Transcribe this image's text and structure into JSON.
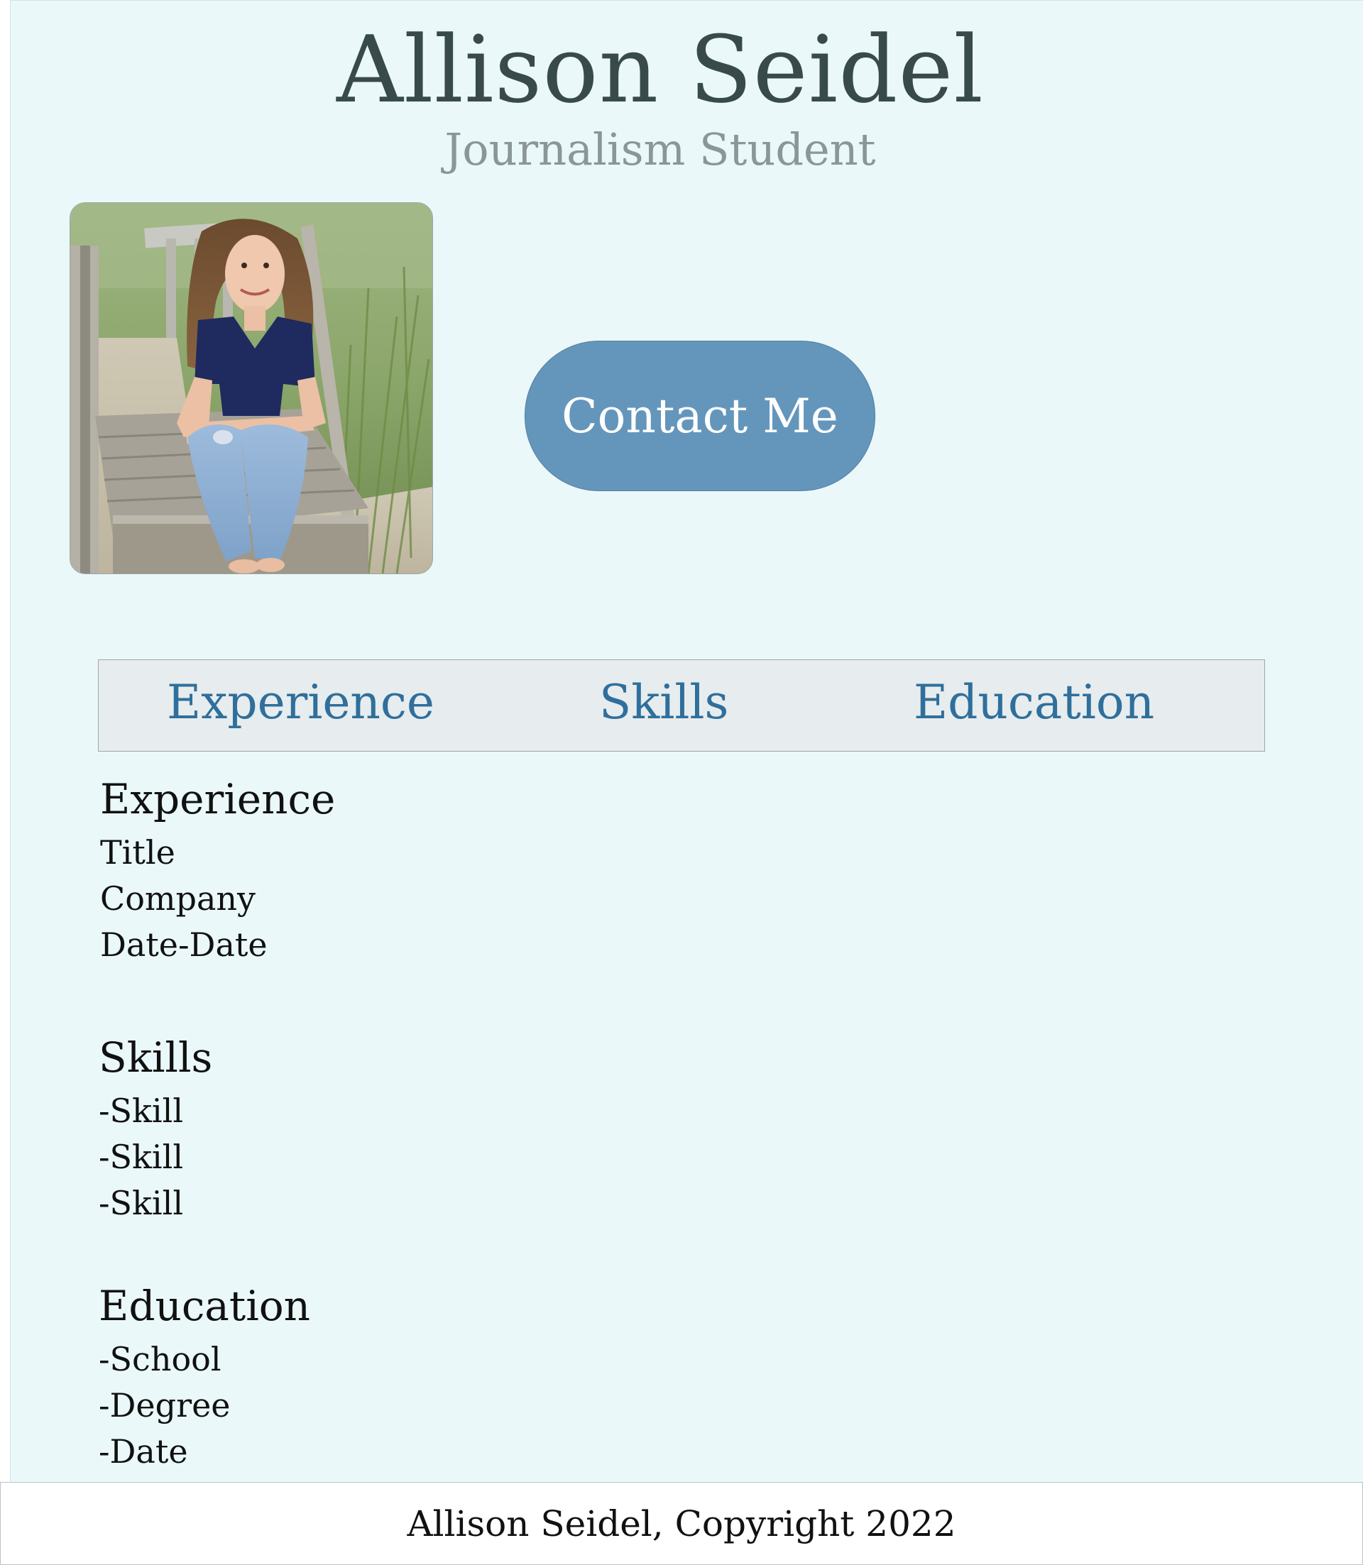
{
  "header": {
    "name": "Allison Seidel",
    "subtitle": "Journalism Student"
  },
  "photo": {
    "alt": "Portrait of Allison Seidel sitting on a wooden boardwalk"
  },
  "contact_button": {
    "label": "Contact Me"
  },
  "nav": {
    "items": [
      {
        "label": "Experience"
      },
      {
        "label": "Skills"
      },
      {
        "label": "Education"
      }
    ]
  },
  "experience": {
    "heading": "Experience",
    "lines": [
      "Title",
      "Company",
      "Date-Date"
    ]
  },
  "skills": {
    "heading": "Skills",
    "lines": [
      "-Skill",
      "-Skill",
      "-Skill"
    ]
  },
  "education": {
    "heading": "Education",
    "lines": [
      "-School",
      "-Degree",
      "-Date"
    ]
  },
  "footer": {
    "text": "Allison Seidel, Copyright 2022"
  },
  "colors": {
    "page_bg": "#eaf8fa",
    "button_bg": "#6496bc",
    "nav_bg": "#e7ecee",
    "nav_link": "#2f6f9c",
    "title": "#394a4a",
    "subtitle": "#8b9696"
  }
}
